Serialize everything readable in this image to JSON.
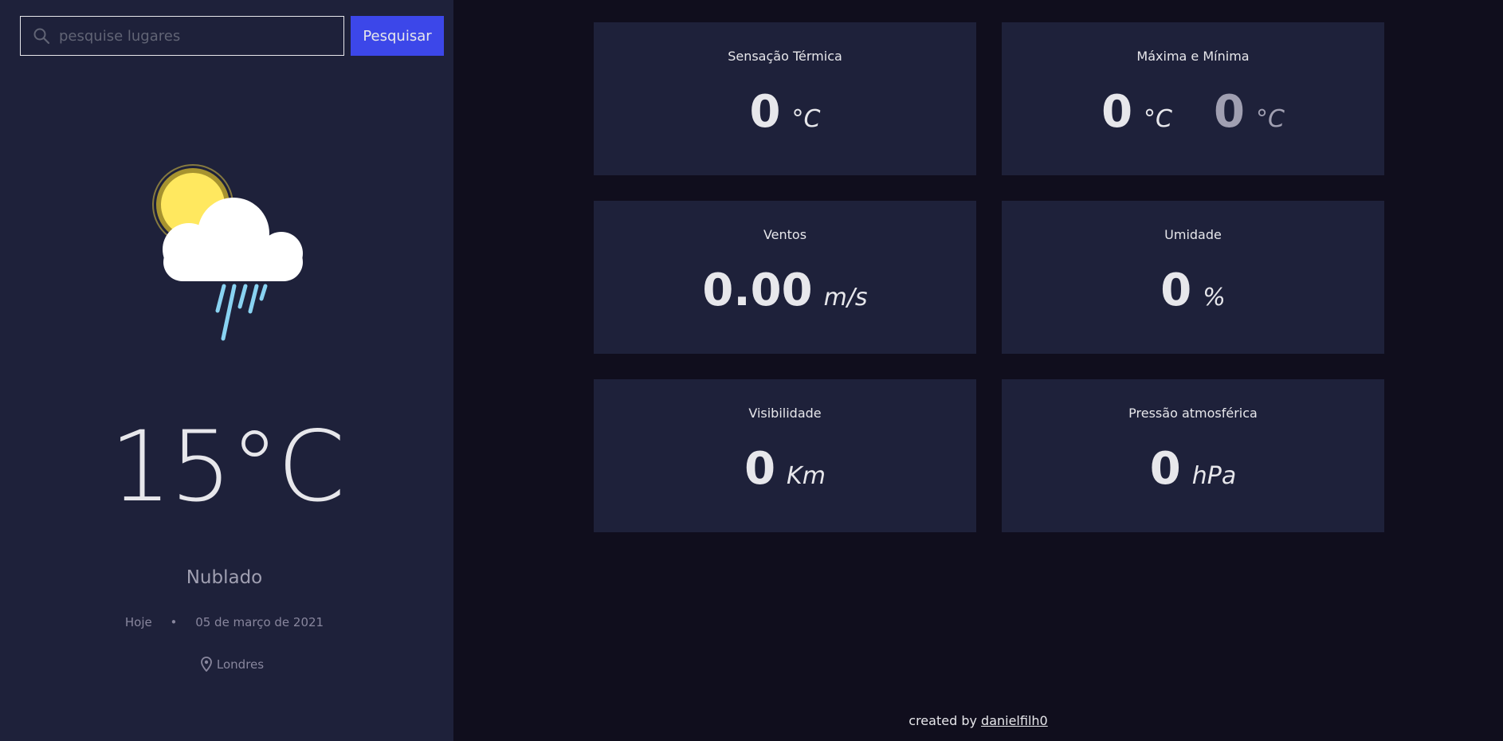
{
  "search": {
    "placeholder": "pesquise lugares",
    "value": "",
    "button_label": "Pesquisar"
  },
  "current": {
    "icon": "sun-cloud-rain-icon",
    "temperature": "15°C",
    "condition": "Nublado",
    "day_label": "Hoje",
    "separator": "•",
    "date": "05 de março de 2021",
    "location": "Londres"
  },
  "cards": {
    "feels_like": {
      "title": "Sensação Térmica",
      "value": "0",
      "unit": "°C"
    },
    "max_min": {
      "title": "Máxima e Mínima",
      "max_value": "0",
      "max_unit": "°C",
      "min_value": "0",
      "min_unit": "°C"
    },
    "wind": {
      "title": "Ventos",
      "value": "0.00",
      "unit": "m/s"
    },
    "humidity": {
      "title": "Umidade",
      "value": "0",
      "unit": "%"
    },
    "visibility": {
      "title": "Visibilidade",
      "value": "0",
      "unit": "Km"
    },
    "pressure": {
      "title": "Pressão atmosférica",
      "value": "0",
      "unit": "hPa"
    }
  },
  "footer": {
    "prefix": "created by",
    "author": "danielfilh0"
  },
  "colors": {
    "background": "#100e1d",
    "panel": "#1e213a",
    "accent": "#3c47e9",
    "text": "#e7e7eb",
    "muted": "#a09fb1"
  }
}
